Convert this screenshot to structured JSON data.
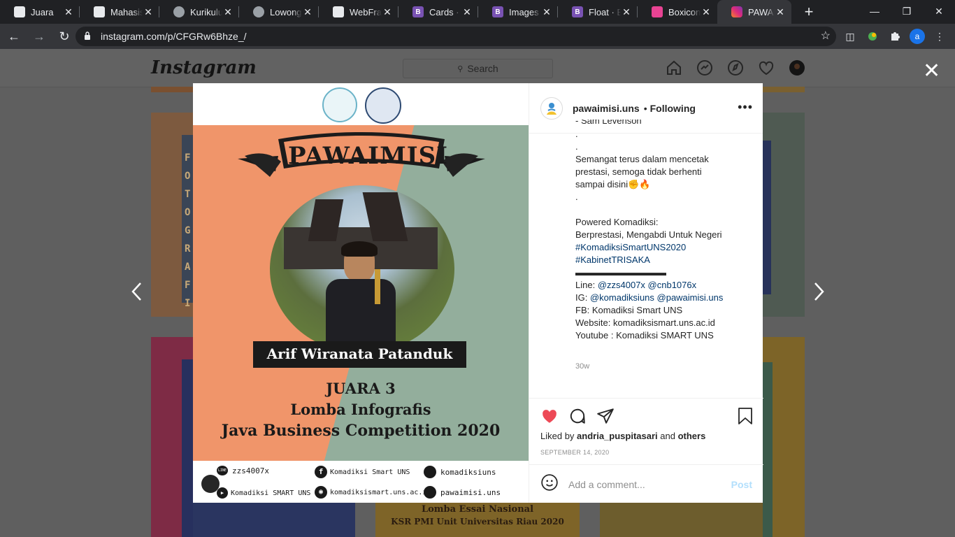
{
  "browser": {
    "tabs": [
      {
        "title": "Juara",
        "favicon": "page-icon",
        "color": "#e8eaed"
      },
      {
        "title": "Mahasiswa",
        "favicon": "page-icon",
        "color": "#e8eaed"
      },
      {
        "title": "Kurikulum",
        "favicon": "globe-icon",
        "color": "#9aa0a6"
      },
      {
        "title": "Lowongan",
        "favicon": "globe-icon",
        "color": "#9aa0a6"
      },
      {
        "title": "WebFrame",
        "favicon": "page-icon",
        "color": "#e8eaed"
      },
      {
        "title": "Cards · Bootstrap",
        "favicon": "B",
        "color": "#7952b3"
      },
      {
        "title": "Images · Bootstrap",
        "favicon": "B",
        "color": "#7952b3"
      },
      {
        "title": "Float · Bootstrap",
        "favicon": "B",
        "color": "#7952b3"
      },
      {
        "title": "Boxicons",
        "favicon": "box-icon",
        "color": "#e84393"
      },
      {
        "title": "PAWAIMISI",
        "favicon": "instagram-icon",
        "color": "#e1306c"
      }
    ],
    "new_tab": "+",
    "url": "instagram.com/p/CFGRw6Bhze_/",
    "profile_initial": "a"
  },
  "instagram": {
    "logo": "Instagram",
    "search_placeholder": "Search",
    "close": "✕"
  },
  "post_image": {
    "banner": "PAWAIMISI",
    "name": "Arif Wiranata Patanduk",
    "award": "JUARA 3",
    "event": "Lomba Infografis",
    "competition": "Java Business Competition 2020",
    "contacts": {
      "line": "zzs4007x",
      "facebook": "Komadiksi Smart UNS",
      "instagram1": "komadiksiuns",
      "youtube": "Komadiksi SMART UNS",
      "website": "komadiksismart.uns.ac.id",
      "instagram2": "pawaimisi.uns"
    }
  },
  "background_posts": {
    "left_vertical_text": "FOTOGRAFI",
    "bottom_center_line1": "Lomba Essai Nasional",
    "bottom_center_line2": "KSR PMI Unit Universitas Riau 2020"
  },
  "post": {
    "username": "pawaimisi.uns",
    "separator": "•",
    "follow_status": "Following",
    "caption_lines": [
      {
        "text": "- Sam Levenson",
        "type": "text"
      },
      {
        "text": ".",
        "type": "text"
      },
      {
        "text": ".",
        "type": "text"
      },
      {
        "text": "Semangat terus dalam mencetak",
        "type": "text"
      },
      {
        "text": "prestasi, semoga tidak berhenti",
        "type": "text"
      },
      {
        "text": "sampai disini✊🔥",
        "type": "text"
      },
      {
        "text": ".",
        "type": "text"
      },
      {
        "text": "",
        "type": "text"
      },
      {
        "text": "Powered Komadiksi:",
        "type": "text"
      },
      {
        "text": "Berprestasi, Mengabdi Untuk Negeri",
        "type": "text"
      },
      {
        "text": "#KomadiksiSmartUNS2020",
        "type": "tag"
      },
      {
        "text": "#KabinetTRISAKA",
        "type": "tag"
      },
      {
        "text": "▬▬▬▬▬▬▬▬▬▬",
        "type": "text"
      }
    ],
    "line_label": "Line: ",
    "line_handles": "@zzs4007x @cnb1076x",
    "ig_label": "IG: ",
    "ig_handles": "@komadiksiuns @pawaimisi.uns",
    "fb": "FB: Komadiksi Smart UNS",
    "website": "Website: komadiksismart.uns.ac.id",
    "youtube": "Youtube : Komadiksi SMART UNS",
    "time_ago": "30w",
    "liked_prefix": "Liked by ",
    "liked_user": "andria_puspitasari",
    "liked_and": " and ",
    "liked_others": "others",
    "date": "SEPTEMBER 14, 2020",
    "comment_placeholder": "Add a comment...",
    "post_button": "Post"
  }
}
